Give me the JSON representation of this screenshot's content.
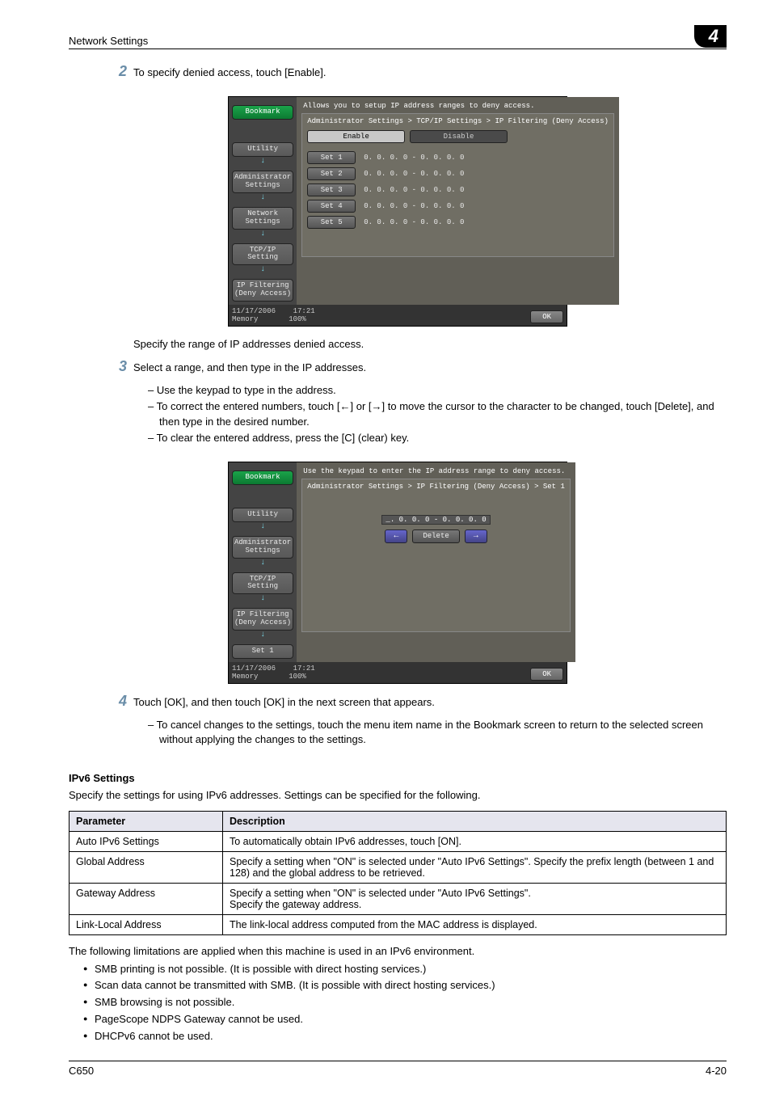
{
  "header": {
    "title": "Network Settings",
    "chapter": "4"
  },
  "step2": {
    "num": "2",
    "text": "To specify denied access, touch [Enable].",
    "after_img": "Specify the range of IP addresses denied access."
  },
  "device1": {
    "instr": "Allows you to setup IP address ranges to deny access.",
    "breadcrumb": "Administrator Settings > TCP/IP Settings > IP Filtering (Deny Access)",
    "side": {
      "bookmark": "Bookmark",
      "utility": "Utility",
      "admin": "Administrator\nSettings",
      "network": "Network\nSettings",
      "tcpip": "TCP/IP Setting",
      "ipfilter": "IP Filtering\n(Deny Access)"
    },
    "tabs": {
      "enable": "Enable",
      "disable": "Disable"
    },
    "sets": [
      "Set 1",
      "Set 2",
      "Set 3",
      "Set 4",
      "Set 5"
    ],
    "ip_line": "0.  0.  0.  0 -   0.  0.  0.  0",
    "footer": {
      "date": "11/17/2006",
      "time": "17:21",
      "mem": "Memory",
      "mempct": "100%",
      "ok": "OK"
    }
  },
  "step3": {
    "num": "3",
    "text": "Select a range, and then type in the IP addresses.",
    "bullets": [
      "Use the keypad to type in the address.",
      "To correct the entered numbers, touch [←] or [→] to move the cursor to the character to be changed, touch [Delete], and then type in the desired number.",
      "To clear the entered address, press the [C] (clear) key."
    ]
  },
  "device2": {
    "instr": "Use the keypad to enter the IP address range to deny access.",
    "breadcrumb": "Administrator Settings > IP Filtering (Deny Access) > Set 1",
    "side": {
      "bookmark": "Bookmark",
      "utility": "Utility",
      "admin": "Administrator\nSettings",
      "tcpip": "TCP/IP Setting",
      "ipfilter": "IP Filtering\n(Deny Access)",
      "set1": "Set 1"
    },
    "ip_line": "_.  0.  0.  0 -   0.  0.  0.  0",
    "delete": "Delete",
    "footer": {
      "date": "11/17/2006",
      "time": "17:21",
      "mem": "Memory",
      "mempct": "100%",
      "ok": "OK"
    }
  },
  "step4": {
    "num": "4",
    "text": "Touch [OK], and then touch [OK] in the next screen that appears.",
    "bullets": [
      "To cancel changes to the settings, touch the menu item name in the Bookmark screen to return to the selected screen without applying the changes to the settings."
    ]
  },
  "ipv6": {
    "heading": "IPv6 Settings",
    "intro": "Specify the settings for using IPv6 addresses. Settings can be specified for the following.",
    "table": {
      "h1": "Parameter",
      "h2": "Description",
      "rows": [
        {
          "p": "Auto IPv6 Settings",
          "d": "To automatically obtain IPv6 addresses, touch [ON]."
        },
        {
          "p": "Global Address",
          "d": "Specify a setting when \"ON\" is selected under \"Auto IPv6 Settings\". Specify the prefix length (between 1 and 128) and the global address to be retrieved."
        },
        {
          "p": "Gateway Address",
          "d": "Specify a setting when \"ON\" is selected under \"Auto IPv6 Settings\".\nSpecify the gateway address."
        },
        {
          "p": "Link-Local Address",
          "d": "The link-local address computed from the MAC address is displayed."
        }
      ]
    },
    "after_table": "The following limitations are applied when this machine is used in an IPv6 environment.",
    "bullets": [
      "SMB printing is not possible. (It is possible with direct hosting services.)",
      "Scan data cannot be transmitted with SMB. (It is possible with direct hosting services.)",
      "SMB browsing is not possible.",
      "PageScope NDPS Gateway cannot be used.",
      "DHCPv6 cannot be used."
    ]
  },
  "footer": {
    "left": "C650",
    "right": "4-20"
  }
}
